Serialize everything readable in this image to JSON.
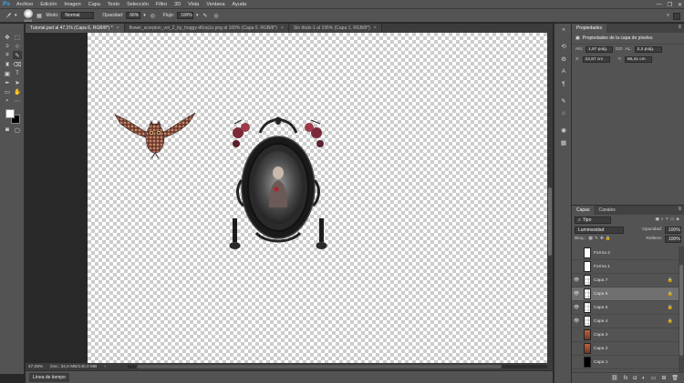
{
  "app": {
    "logo": "Ps"
  },
  "menu": [
    "Archivo",
    "Edición",
    "Imagen",
    "Capa",
    "Texto",
    "Selección",
    "Filtro",
    "3D",
    "Vista",
    "Ventana",
    "Ayuda"
  ],
  "window_controls": {
    "minimize": "—",
    "maximize": "❐",
    "close": "✕"
  },
  "options": {
    "brush_size": "1000",
    "mode_label": "Modo:",
    "mode_value": "Normal",
    "opacity_label": "Opacidad:",
    "opacity_value": "66%",
    "flow_label": "Flujo:",
    "flow_value": "100%"
  },
  "doc_tabs": [
    {
      "label": "Tutorial.psd al 47,1% (Capa 6, RGB/8*) *",
      "active": true
    },
    {
      "label": "flower_scorpion_vol_2_by_hoggy-d6oq1o.png al 100% (Capa 0, RGB/8*)",
      "active": false
    },
    {
      "label": "Sin título-1 al 195% (Capa 1, RGB/8*)",
      "active": false
    }
  ],
  "status": {
    "zoom": "47,08%",
    "doc": "Doc: 34,0 MB/140,0 MB"
  },
  "timeline": {
    "label": "Línea de tiempo"
  },
  "properties": {
    "tab": "Propiedades",
    "title": "Propiedades de la capa de píxeles",
    "an_label": "AN:",
    "an_value": "1,97 pulg.",
    "go_label": "GO",
    "al_label": "AL:",
    "al_value": "2,2 pulg.",
    "x_label": "X:",
    "x_value": "22,67 cm",
    "y_label": "Y:",
    "y_value": "86,41 cm"
  },
  "layers_panel": {
    "tabs": [
      "Capas",
      "Canales"
    ],
    "filter_label": "Tipo",
    "blend_mode": "Luminosidad",
    "opacity_label": "Opacidad:",
    "opacity_value": "100%",
    "lock_label": "Bloq.:",
    "fill_label": "Relleno:",
    "fill_value": "100%",
    "layers": [
      {
        "name": "Forma 2",
        "visible": false,
        "thumb": "shape",
        "locked": false,
        "selected": false
      },
      {
        "name": "Forma 1",
        "visible": false,
        "thumb": "shape",
        "locked": false,
        "selected": false
      },
      {
        "name": "Capa 7",
        "visible": true,
        "thumb": "transparent",
        "locked": true,
        "selected": false
      },
      {
        "name": "Capa 6",
        "visible": true,
        "thumb": "transparent",
        "locked": true,
        "selected": true
      },
      {
        "name": "Capa 5",
        "visible": true,
        "thumb": "transparent",
        "locked": true,
        "selected": false
      },
      {
        "name": "Capa 4",
        "visible": true,
        "thumb": "transparent",
        "locked": true,
        "selected": false
      },
      {
        "name": "Capa 3",
        "visible": false,
        "thumb": "photo",
        "locked": false,
        "selected": false
      },
      {
        "name": "Capa 2",
        "visible": false,
        "thumb": "photo",
        "locked": false,
        "selected": false
      },
      {
        "name": "Capa 1",
        "visible": false,
        "thumb": "dark",
        "locked": false,
        "selected": false
      }
    ]
  },
  "colors": {
    "accent": "#31a8ff",
    "panel": "#535353",
    "dark": "#282828"
  }
}
